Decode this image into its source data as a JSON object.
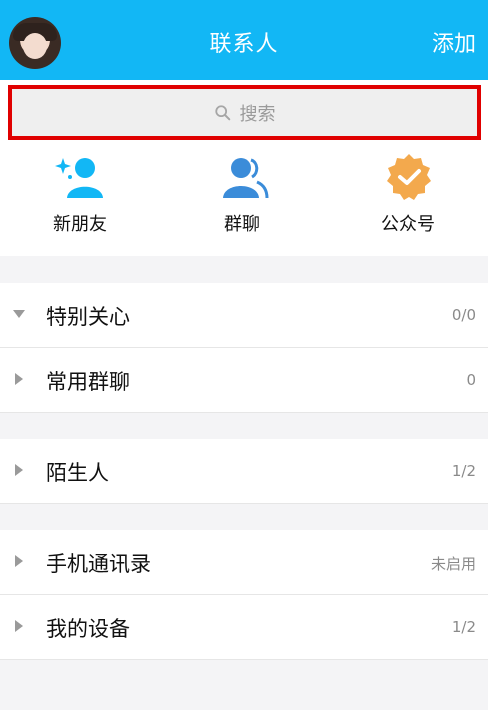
{
  "header": {
    "title": "联系人",
    "add_label": "添加"
  },
  "search": {
    "placeholder": "搜索"
  },
  "quick_actions": [
    {
      "label": "新朋友",
      "icon": "new-friend-icon",
      "color": "#12b7f5"
    },
    {
      "label": "群聊",
      "icon": "group-chat-icon",
      "color": "#3b8cd9"
    },
    {
      "label": "公众号",
      "icon": "official-account-icon",
      "color": "#f3a94d"
    }
  ],
  "sections": [
    {
      "rows": [
        {
          "label": "特别关心",
          "count": "0/0",
          "expanded": true
        },
        {
          "label": "常用群聊",
          "count": "0",
          "expanded": false
        }
      ]
    },
    {
      "rows": [
        {
          "label": "陌生人",
          "count": "1/2",
          "expanded": false
        }
      ]
    },
    {
      "rows": [
        {
          "label": "手机通讯录",
          "count": "未启用",
          "expanded": false
        },
        {
          "label": "我的设备",
          "count": "1/2",
          "expanded": false
        }
      ]
    }
  ],
  "colors": {
    "accent": "#12b7f5",
    "highlight_border": "#e00000",
    "muted_text": "#8a8a8a"
  }
}
